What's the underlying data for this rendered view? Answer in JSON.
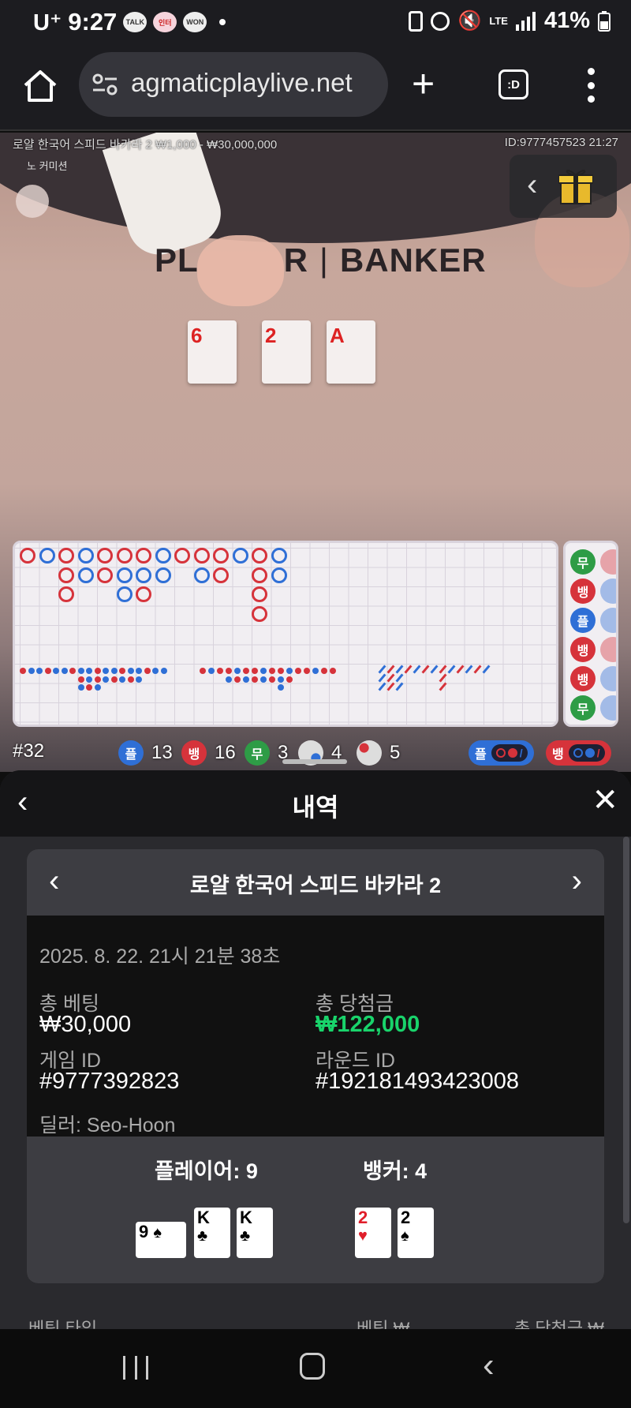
{
  "status_bar": {
    "carrier": "U⁺",
    "time": "9:27",
    "apps": [
      "TALK",
      "인터",
      "WON"
    ],
    "lte": "LTE",
    "battery": "41%"
  },
  "browser": {
    "url": "agmaticplaylive.net",
    "tabs_label": ":D"
  },
  "game": {
    "table_label": "로얄 한국어 스피드 바카라 2  ₩1,000 - ₩30,000,000",
    "table_id": "ID:9777457523  21:27",
    "no_commission": "노 커미션",
    "player_label": "PL",
    "player_label_tail": "R",
    "banker_label": "BANKER",
    "table_cards": [
      "6",
      "2",
      "A"
    ]
  },
  "road_side": [
    "무",
    "뱅",
    "플",
    "뱅",
    "뱅",
    "무"
  ],
  "stats": {
    "round": "#32",
    "player_label": "플",
    "player_count": "13",
    "banker_label": "뱅",
    "banker_count": "16",
    "tie_label": "무",
    "tie_count": "3",
    "player_pair_count": "4",
    "banker_pair_count": "5",
    "pill_player": "플",
    "pill_banker": "뱅"
  },
  "history": {
    "title": "내역",
    "game_name": "로얄 한국어 스피드 바카라 2",
    "datetime": "2025. 8. 22. 21시 21분 38초",
    "total_bet_label": "총 베팅",
    "total_bet": "₩30,000",
    "total_win_label": "총 당첨금",
    "total_win": "₩122,000",
    "game_id_label": "게임 ID",
    "game_id": "#9777392823",
    "round_id_label": "라운드 ID",
    "round_id": "#192181493423008",
    "dealer": "딜러: Seo-Hoon",
    "player_hand_label": "플레이어: 9",
    "banker_hand_label": "뱅커: 4",
    "player_cards": [
      {
        "rank": "9",
        "suit": "♠"
      },
      {
        "rank": "K",
        "suit": "♣"
      },
      {
        "rank": "K",
        "suit": "♣"
      }
    ],
    "banker_cards": [
      {
        "rank": "2",
        "suit": "♥"
      },
      {
        "rank": "2",
        "suit": "♠"
      }
    ],
    "bet_type_header": "베팅 타입",
    "bet_header": "베팅 ₩",
    "total_win_header": "총 당첨금 ₩"
  },
  "colors": {
    "player": "#2f6fd6",
    "banker": "#d6333b",
    "tie": "#2e9c46",
    "win_green": "#19d36b"
  }
}
